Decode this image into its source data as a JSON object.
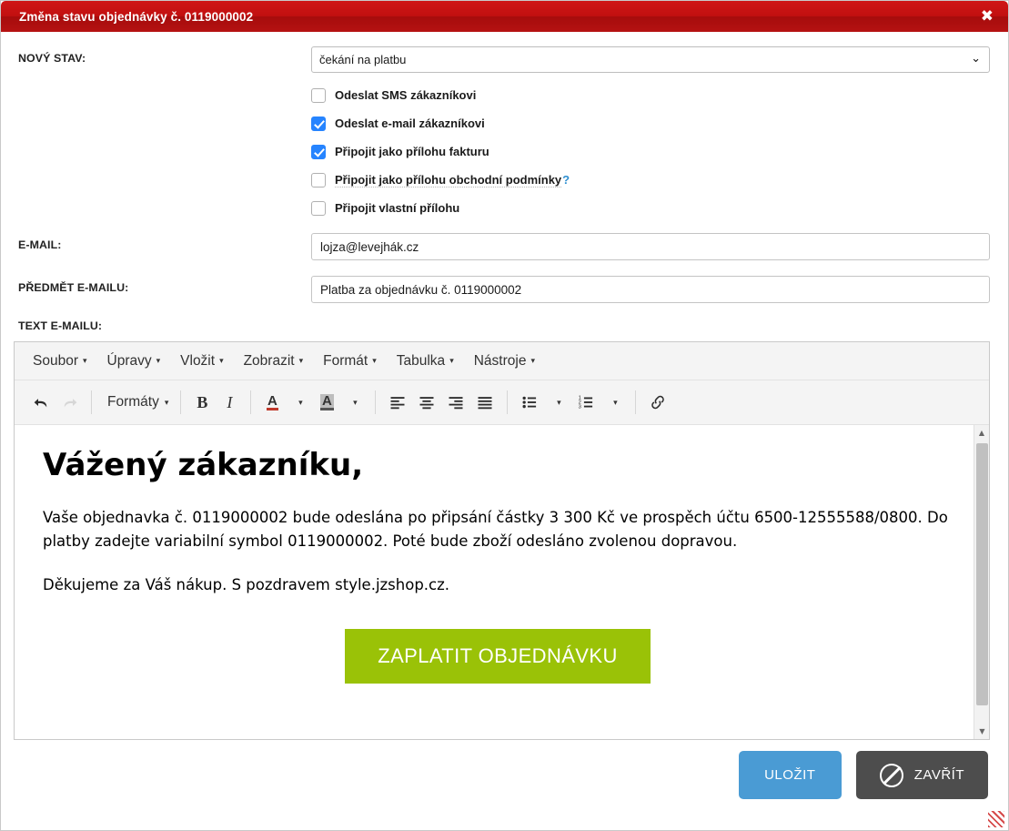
{
  "titlebar": {
    "title": "Změna stavu objednávky č. 0119000002",
    "close_glyph": "✖"
  },
  "form": {
    "state_label": "NOVÝ STAV:",
    "state_value": "čekání na platbu",
    "state_options": [
      "čekání na platbu"
    ],
    "chevron": "⌄",
    "checkboxes": [
      {
        "label": "Odeslat SMS zákazníkovi",
        "checked": false,
        "hint": false
      },
      {
        "label": "Odeslat e-mail zákazníkovi",
        "checked": true,
        "hint": false
      },
      {
        "label": "Připojit jako přílohu fakturu",
        "checked": true,
        "hint": false
      },
      {
        "label": "Připojit jako přílohu obchodní podmínky",
        "checked": false,
        "hint": true,
        "help": "?"
      },
      {
        "label": "Připojit vlastní přílohu",
        "checked": false,
        "hint": false
      }
    ],
    "email_label": "E-MAIL:",
    "email_value": "lojza@levejhák.cz",
    "subject_label": "PŘEDMĚT E-MAILU:",
    "subject_value": "Platba za objednávku č. 0119000002",
    "text_label": "TEXT E-MAILU:"
  },
  "editor": {
    "menu": [
      {
        "label": "Soubor"
      },
      {
        "label": "Úpravy"
      },
      {
        "label": "Vložit"
      },
      {
        "label": "Zobrazit"
      },
      {
        "label": "Formát"
      },
      {
        "label": "Tabulka"
      },
      {
        "label": "Nástroje"
      }
    ],
    "menu_caret": "▾",
    "toolbar": {
      "undo": "↰",
      "redo": "↱",
      "formats_label": "Formáty",
      "bold": "B",
      "italic": "I",
      "text_color": "A",
      "bg_color": "A",
      "align_left": "align-left",
      "align_center": "align-center",
      "align_right": "align-right",
      "align_justify": "align-justify",
      "bullet_list": "bullet-list",
      "numbered_list": "numbered-list",
      "link": "🔗",
      "caret": "▾"
    },
    "content": {
      "heading": "Vážený zákazníku,",
      "paragraph1": "Vaše objednavka č. 0119000002 bude odeslána po připsání částky 3 300 Kč ve prospěch účtu 6500-12555588/0800. Do platby zadejte variabilní symbol 0119000002. Poté bude zboží odesláno zvolenou dopravou.",
      "paragraph2": "Děkujeme za Váš nákup. S pozdravem style.jzshop.cz.",
      "pay_button": "ZAPLATIT OBJEDNÁVKU",
      "pay_button_color": "#9ac207"
    },
    "scrollbar": {
      "up": "▲",
      "down": "▼"
    }
  },
  "footer": {
    "save_label": "ULOŽIT",
    "close_label": "ZAVŘÍT",
    "save_color": "#4a9bd4",
    "close_color": "#4d4d4d"
  }
}
